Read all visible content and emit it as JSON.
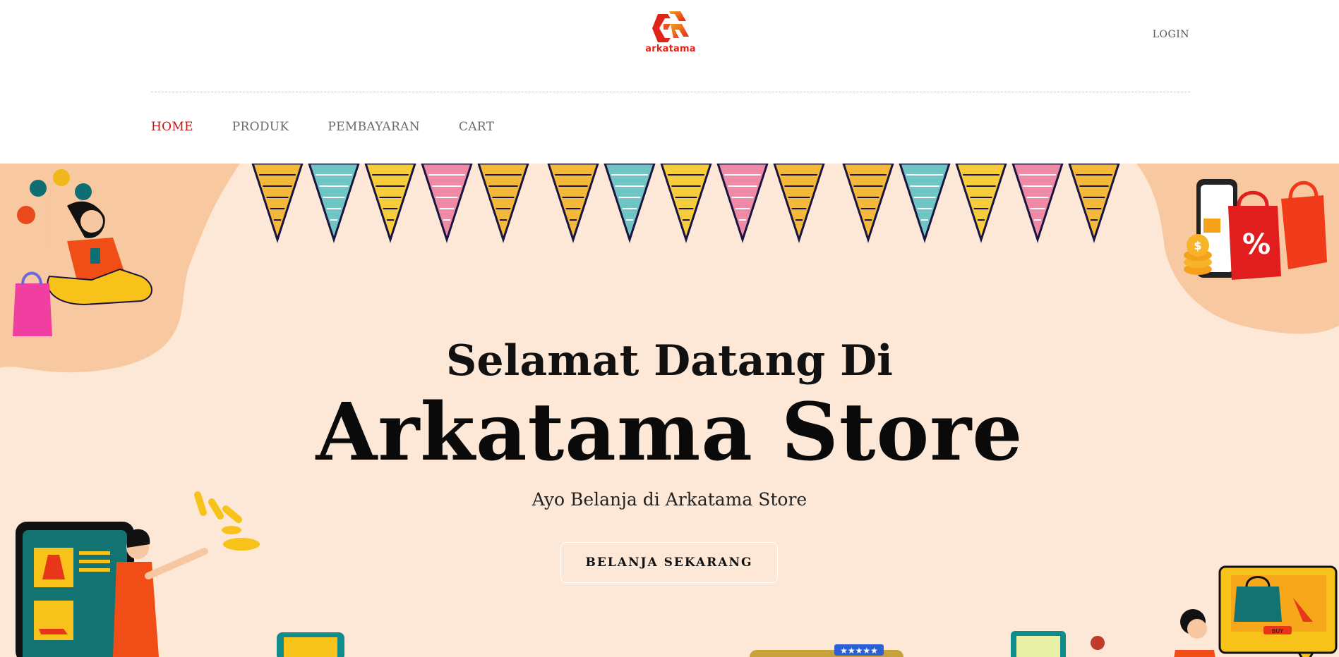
{
  "brand": {
    "name": "arkatama",
    "accent": "#e0241a"
  },
  "header": {
    "login_label": "LOGIN"
  },
  "nav": {
    "items": [
      {
        "label": "HOME",
        "active": true
      },
      {
        "label": "PRODUK",
        "active": false
      },
      {
        "label": "PEMBAYARAN",
        "active": false
      },
      {
        "label": "CART",
        "active": false
      }
    ],
    "active_color": "#c41414"
  },
  "hero": {
    "pretitle": "Selamat Datang Di",
    "title": "Arkatama Store",
    "tagline": "Ayo Belanja di Arkatama Store",
    "cta_label": "BELANJA SEKARANG",
    "background": "#fde8d7"
  },
  "icons": [
    "arkatama-logo-icon",
    "bunting-flags",
    "woman-with-phone-illustration",
    "shopping-bags-percent-illustration",
    "woman-pointing-phone-store-illustration",
    "online-shop-screen-illustration"
  ]
}
